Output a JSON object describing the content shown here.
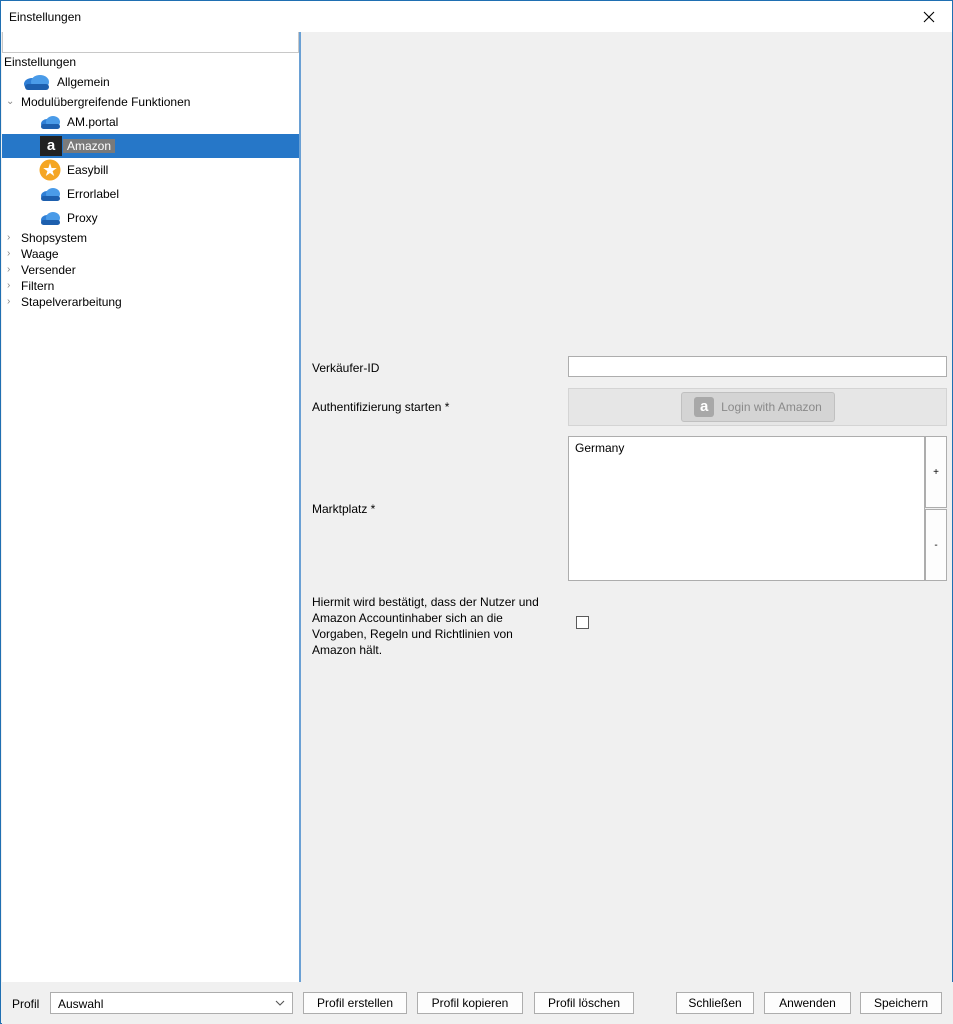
{
  "window": {
    "title": "Einstellungen"
  },
  "tree": {
    "root": "Einstellungen",
    "items": [
      {
        "label": "Allgemein"
      },
      {
        "label": "Modulübergreifende Funktionen"
      },
      {
        "label": "AM.portal"
      },
      {
        "label": "Amazon",
        "icon_glyph": "a"
      },
      {
        "label": "Easybill"
      },
      {
        "label": "Errorlabel"
      },
      {
        "label": "Proxy"
      },
      {
        "label": "Shopsystem"
      },
      {
        "label": "Waage"
      },
      {
        "label": "Versender"
      },
      {
        "label": "Filtern"
      },
      {
        "label": "Stapelverarbeitung"
      }
    ]
  },
  "form": {
    "seller_id_label": "Verkäufer-ID",
    "seller_id_value": "",
    "auth_label": "Authentifizierung starten *",
    "amazon_login_glyph": "a",
    "amazon_login_label": "Login with Amazon",
    "marketplace_label": "Marktplatz *",
    "marketplace_items": [
      "Germany"
    ],
    "add_label": "+",
    "remove_label": "-",
    "confirm_text": "Hiermit wird bestätigt, dass der Nutzer und Amazon Accountinhaber sich an die Vorgaben, Regeln und Richtlinien von Amazon hält."
  },
  "footer": {
    "profile_label": "Profil",
    "profile_value": "Auswahl",
    "create_profile": "Profil erstellen",
    "copy_profile": "Profil kopieren",
    "delete_profile": "Profil löschen",
    "close": "Schließen",
    "apply": "Anwenden",
    "save": "Speichern"
  },
  "colors": {
    "selection": "#2677c8",
    "panel_border": "#6aa0d4",
    "easybill": "#f5a623",
    "cloud": "#2f7fd6"
  }
}
